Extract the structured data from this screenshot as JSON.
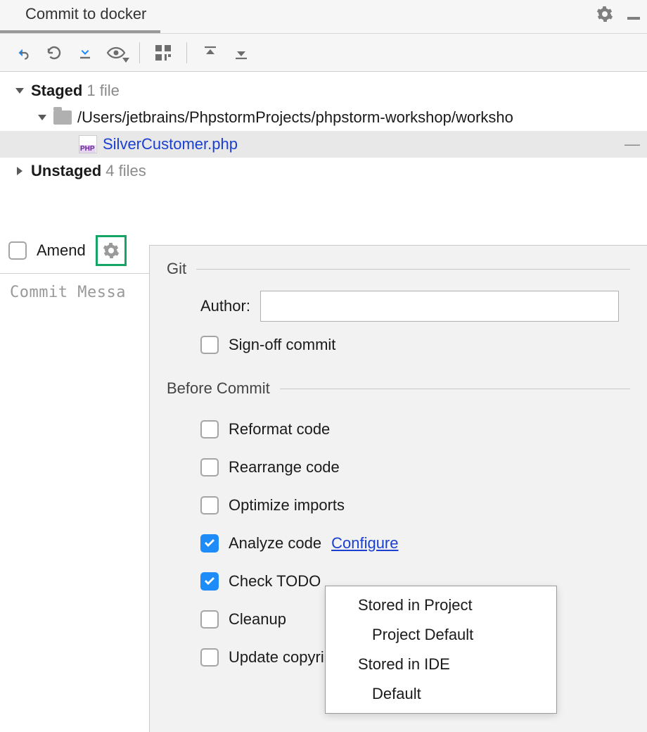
{
  "tab": {
    "title": "Commit to docker"
  },
  "tree": {
    "staged": {
      "label": "Staged",
      "count_label": "1 file"
    },
    "path": "/Users/jetbrains/PhpstormProjects/phpstorm-workshop/worksho",
    "file": "SilverCustomer.php",
    "unstaged": {
      "label": "Unstaged",
      "count_label": "4 files"
    }
  },
  "amend": {
    "label": "Amend"
  },
  "commit_msg": {
    "placeholder": "Commit Messa"
  },
  "panel": {
    "git": {
      "header": "Git",
      "author_label": "Author:",
      "signoff": "Sign-off commit"
    },
    "before": {
      "header": "Before Commit",
      "reformat": "Reformat code",
      "rearrange": "Rearrange code",
      "optimize": "Optimize imports",
      "analyze": "Analyze code",
      "configure": "Configure",
      "check_todo": "Check TODO",
      "cleanup": "Cleanup",
      "update_copy": "Update copyri"
    }
  },
  "popup": {
    "stored_project": "Stored in Project",
    "project_default": "Project Default",
    "stored_ide": "Stored in IDE",
    "default": "Default"
  }
}
